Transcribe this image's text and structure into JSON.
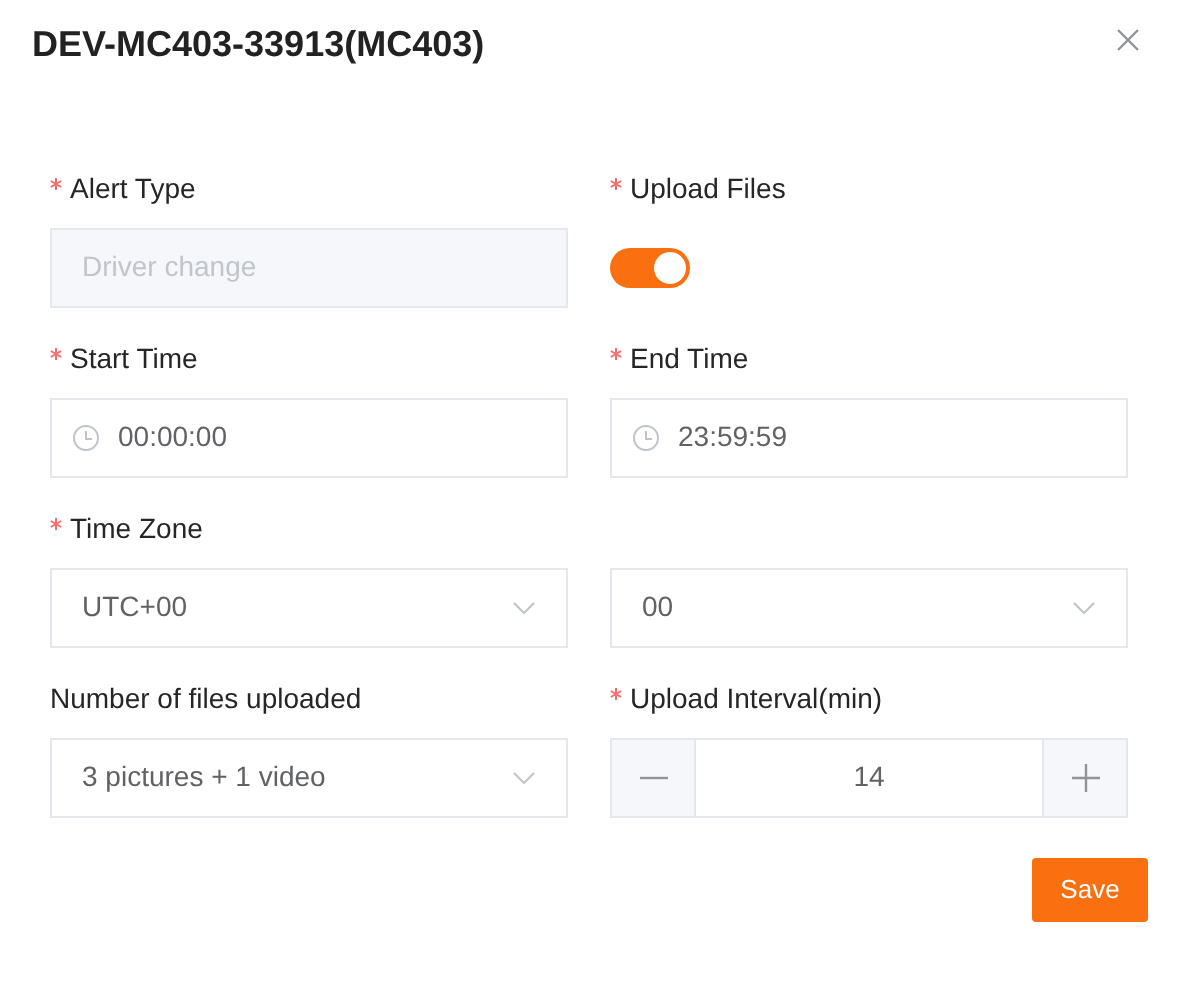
{
  "dialog": {
    "title": "DEV-MC403-33913(MC403)"
  },
  "fields": [
    {
      "label": "Alert Type",
      "required": true,
      "kind": "input",
      "value": "Driver change",
      "disabled": true
    },
    {
      "label": "Upload Files",
      "required": true,
      "kind": "switch",
      "on": true
    },
    {
      "label": "Start Time",
      "required": true,
      "kind": "time",
      "value": "00:00:00"
    },
    {
      "label": "End Time",
      "required": true,
      "kind": "time",
      "value": "23:59:59"
    },
    {
      "label": "Time Zone",
      "required": true,
      "kind": "select",
      "value": "UTC+00"
    },
    {
      "kind": "select",
      "value": "00"
    },
    {
      "label": "Number of files uploaded",
      "required": false,
      "kind": "select",
      "value": "3 pictures + 1 video"
    },
    {
      "label": "Upload Interval(min)",
      "required": true,
      "kind": "number",
      "value": "14"
    }
  ],
  "buttons": [
    {
      "label": "Save"
    }
  ]
}
